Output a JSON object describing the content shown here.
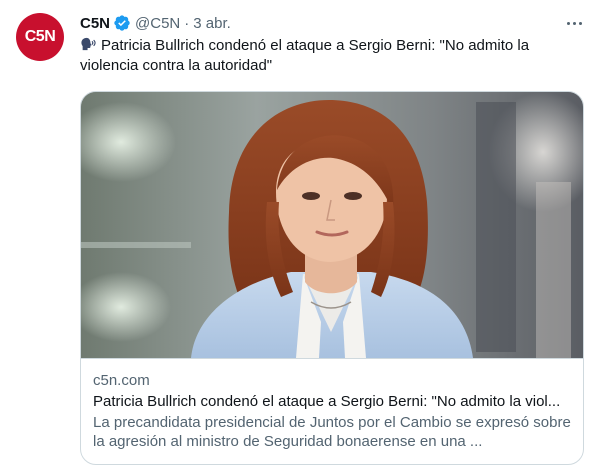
{
  "author": {
    "avatar_text": "C5N",
    "name": "C5N",
    "handle": "@C5N",
    "separator": "·",
    "time": "3 abr."
  },
  "tweet": {
    "emoji": "speaking-head-icon",
    "text": "Patricia Bullrich condenó el ataque a Sergio Berni: \"No admito la violencia contra la autoridad\""
  },
  "card": {
    "image": "photo of a woman with auburn hair in a light blue blazer",
    "domain": "c5n.com",
    "title": "Patricia Bullrich condenó el ataque a Sergio Berni: \"No admito la viol...",
    "description": "La precandidata presidencial de Juntos por el Cambio se expresó sobre la agresión al ministro de Seguridad bonaerense en una ..."
  },
  "colors": {
    "brand": "#c8102e",
    "verified": "#1d9bf0",
    "secondary_text": "#536471",
    "border": "#cfd9de"
  }
}
